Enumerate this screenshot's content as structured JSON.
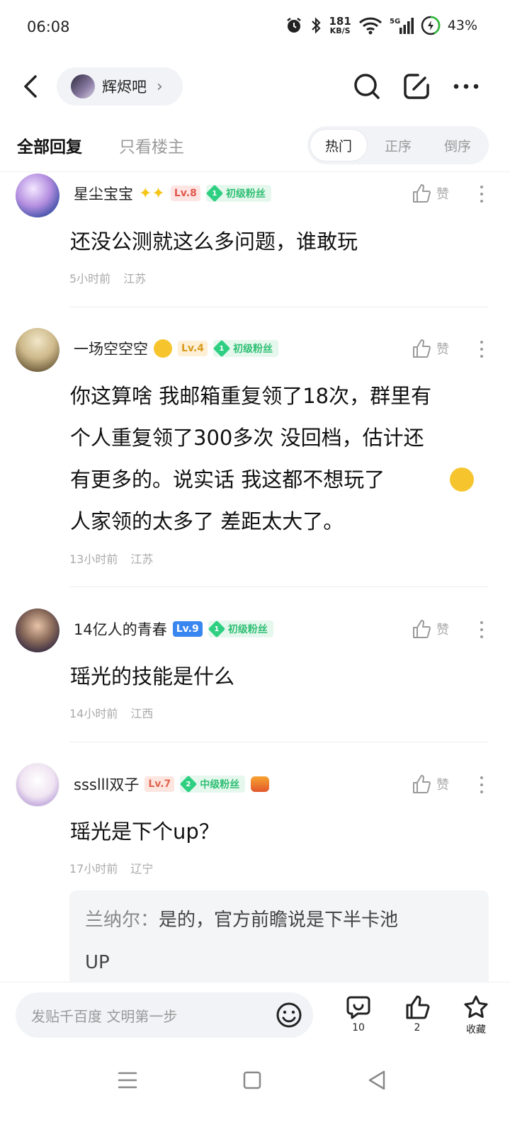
{
  "status": {
    "time": "06:08",
    "speed_value": "181",
    "speed_unit": "KB/S",
    "network": "5G",
    "battery": "43%"
  },
  "header": {
    "forum_name": "辉烬吧"
  },
  "tabs": {
    "all": "全部回复",
    "owner_only": "只看楼主"
  },
  "sort": {
    "hot": "热门",
    "asc": "正序",
    "desc": "倒序",
    "active": "hot"
  },
  "like_label": "赞",
  "comments": [
    {
      "username": "星尘宝宝",
      "level": "Lv.8",
      "fan_num": "1",
      "fan_label": "初级粉丝",
      "text": "还没公测就这么多问题，谁敢玩",
      "time": "5小时前",
      "location": "江苏"
    },
    {
      "username": "一场空空空",
      "level": "Lv.4",
      "fan_num": "1",
      "fan_label": "初级粉丝",
      "text_lines": [
        "你这算啥 我邮箱重复领了18次，群里有",
        "个人重复领了300多次 没回档，估计还",
        "有更多的。说实话 我这都不想玩了",
        "人家领的太多了 差距太大了。"
      ],
      "time": "13小时前",
      "location": "江苏"
    },
    {
      "username": "14亿人的青春",
      "level": "Lv.9",
      "fan_num": "1",
      "fan_label": "初级粉丝",
      "text": "瑶光的技能是什么",
      "time": "14小时前",
      "location": "江西"
    },
    {
      "username": "ssslll双子",
      "level": "Lv.7",
      "fan_num": "2",
      "fan_label": "中级粉丝",
      "text": "瑶光是下个up？",
      "time": "17小时前",
      "location": "辽宁",
      "reply": {
        "name": "兰纳尔：",
        "text_line1": "是的，官方前瞻说是下半卡池",
        "text_line2": "UP"
      }
    }
  ],
  "bottom": {
    "placeholder": "发贴千百度 文明第一步",
    "comment_count": "10",
    "like_count": "2",
    "favorite_label": "收藏"
  },
  "colors": {
    "fan_green": "#2fcf82",
    "lv8": "#e2574c",
    "lv4": "#d99a1e",
    "lv9": "#3a86f0",
    "lv7": "#e0664f"
  }
}
